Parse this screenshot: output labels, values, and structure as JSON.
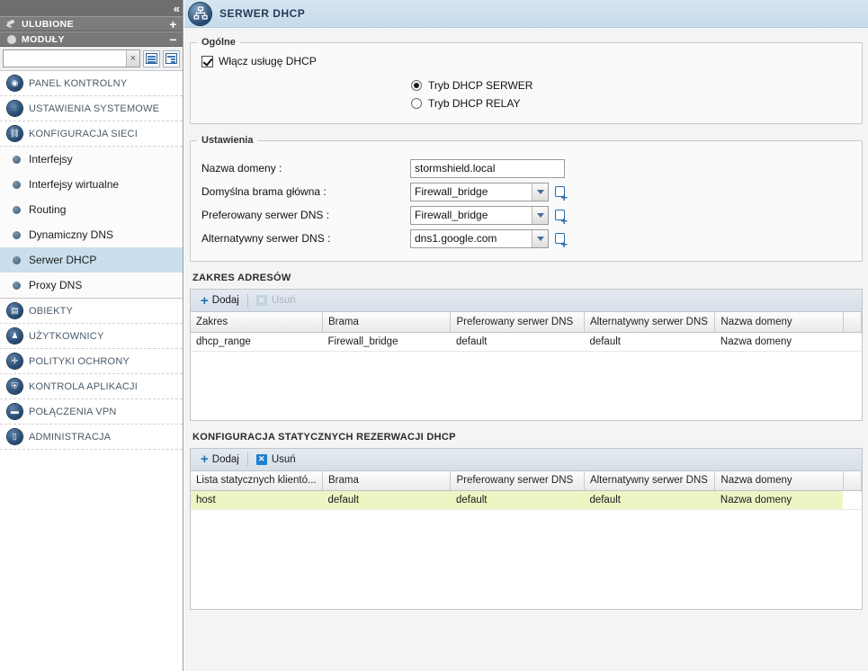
{
  "sidebar": {
    "collapse_icon": "«",
    "groups": [
      {
        "label": "ULUBIONE",
        "icon": "pin-icon",
        "action": "+"
      },
      {
        "label": "MODUŁY",
        "icon": "circle-icon",
        "action": "−"
      }
    ],
    "search": {
      "value": "",
      "placeholder": "",
      "clear_label": "×"
    },
    "view_buttons": [
      "list-view-icon",
      "tree-view-icon"
    ],
    "modules": [
      {
        "label": "PANEL KONTROLNY",
        "icon": "dashboard-icon"
      },
      {
        "label": "USTAWIENIA SYSTEMOWE",
        "icon": "system-settings-icon"
      },
      {
        "label": "KONFIGURACJA SIECI",
        "icon": "network-config-icon"
      }
    ],
    "sub_items": [
      {
        "label": "Interfejsy",
        "active": false
      },
      {
        "label": "Interfejsy wirtualne",
        "active": false
      },
      {
        "label": "Routing",
        "active": false
      },
      {
        "label": "Dynamiczny DNS",
        "active": false
      },
      {
        "label": "Serwer DHCP",
        "active": true
      },
      {
        "label": "Proxy DNS",
        "active": false
      }
    ],
    "modules_after": [
      {
        "label": "OBIEKTY",
        "icon": "objects-icon"
      },
      {
        "label": "UŻYTKOWNICY",
        "icon": "users-icon"
      },
      {
        "label": "POLITYKI OCHRONY",
        "icon": "protection-policies-icon"
      },
      {
        "label": "KONTROLA APLIKACJI",
        "icon": "application-control-icon"
      },
      {
        "label": "POŁĄCZENIA VPN",
        "icon": "vpn-icon"
      },
      {
        "label": "ADMINISTRACJA",
        "icon": "administration-icon"
      }
    ]
  },
  "header": {
    "title": "SERWER DHCP",
    "icon": "dhcp-server-icon"
  },
  "general_panel": {
    "legend": "Ogólne",
    "enable_checkbox": {
      "label": "Włącz usługę DHCP",
      "checked": true
    },
    "modes": [
      {
        "label": "Tryb DHCP SERWER",
        "selected": true
      },
      {
        "label": "Tryb DHCP RELAY",
        "selected": false
      }
    ]
  },
  "settings_panel": {
    "legend": "Ustawienia",
    "fields": [
      {
        "label": "Nazwa domeny :",
        "value": "stormshield.local",
        "type": "text"
      },
      {
        "label": "Domyślna brama główna :",
        "value": "Firewall_bridge",
        "type": "select"
      },
      {
        "label": "Preferowany serwer DNS :",
        "value": "Firewall_bridge",
        "type": "select"
      },
      {
        "label": "Alternatywny serwer DNS :",
        "value": "dns1.google.com",
        "type": "select"
      }
    ]
  },
  "ranges_section": {
    "title": "ZAKRES ADRESÓW",
    "toolbar": {
      "add_label": "Dodaj",
      "delete_label": "Usuń",
      "delete_disabled": true
    },
    "columns": [
      "Zakres",
      "Brama",
      "Preferowany serwer DNS",
      "Alternatywny serwer DNS",
      "Nazwa domeny",
      ""
    ],
    "rows": [
      {
        "cells": [
          "dhcp_range",
          "Firewall_bridge",
          "default",
          "default",
          "Nazwa domeny",
          ""
        ],
        "muted_cells": [
          4
        ],
        "selected": false
      }
    ]
  },
  "static_section": {
    "title": "KONFIGURACJA STATYCZNYCH REZERWACJI DHCP",
    "toolbar": {
      "add_label": "Dodaj",
      "delete_label": "Usuń",
      "delete_disabled": false
    },
    "columns": [
      "Lista statycznych klientó...",
      "Brama",
      "Preferowany serwer DNS",
      "Alternatywny serwer DNS",
      "Nazwa domeny",
      ""
    ],
    "rows": [
      {
        "cells": [
          "host",
          "default",
          "default",
          "default",
          "Nazwa domeny",
          ""
        ],
        "muted_cells": [
          4
        ],
        "selected": true
      }
    ]
  },
  "colors": {
    "accent": "#1e6fbf",
    "header_bg": "#cadfee",
    "selected_row": "#edf5c4",
    "sidebar_group": "#7c7c7c"
  }
}
